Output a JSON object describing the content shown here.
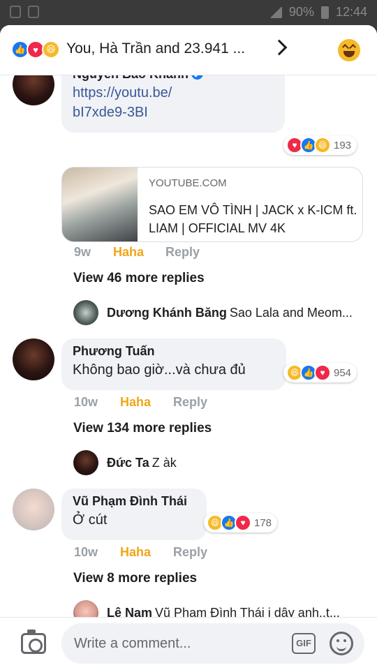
{
  "status_bar": {
    "battery": "90%",
    "time": "12:44"
  },
  "header": {
    "reactions": [
      "like-icon",
      "love-icon",
      "haha-icon"
    ],
    "title": "You, Hà Trần and 23.941 ..."
  },
  "comments": [
    {
      "name": "Nguyễn Bảo Khánh",
      "verified": true,
      "text_line1": "https://youtu.be/",
      "text_line2": "bI7xde9-3BI",
      "reaction_count": "193",
      "reactions": [
        "love-icon",
        "like-icon",
        "haha-icon"
      ],
      "preview": {
        "domain": "YOUTUBE.COM",
        "title": "SAO EM VÔ TÌNH | JACK x K-ICM ft. LIAM | OFFICIAL MV 4K"
      },
      "time": "9w",
      "reaction_label": "Haha",
      "reply_label": "Reply",
      "more_replies": "View 46 more replies",
      "reply_preview": {
        "name": "Dương Khánh Băng",
        "text": "Sao Lala and Meom..."
      }
    },
    {
      "name": "Phương Tuấn",
      "text": "Không bao giờ...và chưa đủ",
      "reaction_count": "954",
      "reactions": [
        "haha-icon",
        "like-icon",
        "love-icon"
      ],
      "time": "10w",
      "reaction_label": "Haha",
      "reply_label": "Reply",
      "more_replies": "View 134 more replies",
      "reply_preview": {
        "name": "Đức Ta",
        "text": "Z àk"
      }
    },
    {
      "name": "Vũ Phạm Đình Thái",
      "text": "Ở cút",
      "reaction_count": "178",
      "reactions": [
        "haha-icon",
        "like-icon",
        "love-icon"
      ],
      "time": "10w",
      "reaction_label": "Haha",
      "reply_label": "Reply",
      "more_replies": "View 8 more replies",
      "reply_preview": {
        "name": "Lê Nam",
        "text": "Vũ Phạm Đình Thái j dậy anh..t..."
      }
    }
  ],
  "composer": {
    "placeholder": "Write a comment...",
    "gif_label": "GIF"
  },
  "colors": {
    "accent": "#1877f2",
    "love": "#f02849",
    "haha": "#f7b928",
    "haha_text": "#f0a618"
  }
}
